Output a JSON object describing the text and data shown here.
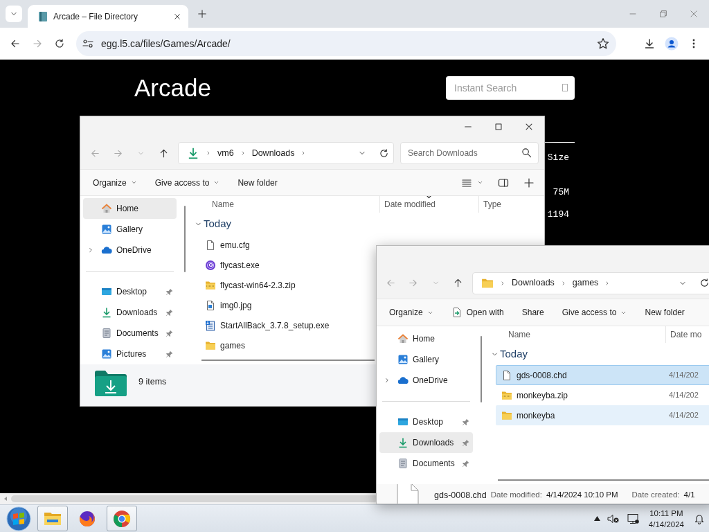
{
  "browser": {
    "tabs": [
      {
        "title": "Arcade – File Directory",
        "selected": true
      }
    ],
    "url": "egg.l5.ca/files/Games/Arcade/"
  },
  "page": {
    "heading": "Arcade",
    "search": {
      "placeholder": "Instant Search"
    },
    "table": {
      "columns": [
        "Size"
      ],
      "rows": [
        [
          "75M"
        ],
        [
          "1194"
        ]
      ]
    }
  },
  "windows": [
    {
      "caption_buttons": true,
      "location": {
        "kind": "downloads",
        "crumbs": [
          "vm6",
          "Downloads"
        ]
      },
      "search": {
        "placeholder": "Search Downloads"
      },
      "toolbar": [
        {
          "label": "Organize",
          "kind": "menu"
        },
        {
          "label": "Give access to",
          "kind": "menu"
        },
        {
          "label": "New folder",
          "kind": "plain"
        }
      ],
      "view_tools": true,
      "nav": [
        {
          "items": [
            {
              "label": "Home",
              "kind": "home",
              "selected": true,
              "expandable": false,
              "pinned": false
            },
            {
              "label": "Gallery",
              "kind": "gallery",
              "selected": false,
              "expandable": false,
              "pinned": false
            },
            {
              "label": "OneDrive",
              "kind": "cloud",
              "selected": false,
              "expandable": true,
              "pinned": false
            }
          ]
        },
        {
          "items": [
            {
              "label": "Desktop",
              "kind": "desktop",
              "selected": false,
              "expandable": false,
              "pinned": true
            },
            {
              "label": "Downloads",
              "kind": "downloads",
              "selected": false,
              "expandable": false,
              "pinned": true
            },
            {
              "label": "Documents",
              "kind": "documents",
              "selected": false,
              "expandable": false,
              "pinned": true
            },
            {
              "label": "Pictures",
              "kind": "pictures",
              "selected": false,
              "expandable": false,
              "pinned": true
            }
          ]
        }
      ],
      "columns": [
        {
          "label": "Name",
          "sorted": false
        },
        {
          "label": "Date modified",
          "sorted": true
        },
        {
          "label": "Type",
          "sorted": false
        }
      ],
      "group": "Today",
      "files": [
        {
          "name": "emu.cfg",
          "kind": "file",
          "selected": false,
          "hovered": false
        },
        {
          "name": "flycast.exe",
          "kind": "app",
          "selected": false,
          "hovered": false
        },
        {
          "name": "flycast-win64-2.3.zip",
          "kind": "zip",
          "selected": false,
          "hovered": false
        },
        {
          "name": "img0.jpg",
          "kind": "image",
          "selected": false,
          "hovered": false
        },
        {
          "name": "StartAllBack_3.7.8_setup.exe",
          "kind": "installer",
          "selected": false,
          "hovered": false
        },
        {
          "name": "games",
          "kind": "folder",
          "selected": false,
          "hovered": false
        }
      ],
      "status": {
        "kind": "count",
        "text": "9 items"
      }
    },
    {
      "caption_buttons": false,
      "location": {
        "kind": "folder",
        "crumbs": [
          "Downloads",
          "games"
        ]
      },
      "toolbar": [
        {
          "label": "Organize",
          "kind": "menu"
        },
        {
          "label": "Open with",
          "kind": "open-with"
        },
        {
          "label": "Share",
          "kind": "plain"
        },
        {
          "label": "Give access to",
          "kind": "menu"
        },
        {
          "label": "New folder",
          "kind": "plain"
        }
      ],
      "view_tools": false,
      "nav": [
        {
          "items": [
            {
              "label": "Home",
              "kind": "home",
              "selected": false,
              "expandable": false,
              "pinned": false
            },
            {
              "label": "Gallery",
              "kind": "gallery",
              "selected": false,
              "expandable": false,
              "pinned": false
            },
            {
              "label": "OneDrive",
              "kind": "cloud",
              "selected": false,
              "expandable": true,
              "pinned": false
            }
          ]
        },
        {
          "items": [
            {
              "label": "Desktop",
              "kind": "desktop",
              "selected": false,
              "expandable": false,
              "pinned": true
            },
            {
              "label": "Downloads",
              "kind": "downloads",
              "selected": true,
              "expandable": false,
              "pinned": true
            },
            {
              "label": "Documents",
              "kind": "documents",
              "selected": false,
              "expandable": false,
              "pinned": true
            }
          ]
        }
      ],
      "columns": [
        {
          "label": "Name",
          "sorted": false
        },
        {
          "label": "Date mo",
          "sorted": false
        }
      ],
      "group": "Today",
      "files": [
        {
          "name": "gds-0008.chd",
          "kind": "file",
          "date_modified": "4/14/202",
          "selected": true,
          "hovered": false
        },
        {
          "name": "monkeyba.zip",
          "kind": "zip",
          "date_modified": "4/14/202",
          "selected": false,
          "hovered": false
        },
        {
          "name": "monkeyba",
          "kind": "folder",
          "date_modified": "4/14/202",
          "selected": false,
          "hovered": true
        }
      ],
      "status": {
        "kind": "details",
        "name": "gds-0008.chd",
        "fields": [
          {
            "label": "Date modified:",
            "value": "4/14/2024 10:10 PM"
          },
          {
            "label": "Date created:",
            "value": "4/1"
          }
        ]
      }
    }
  ],
  "taskbar": {
    "apps": [
      {
        "kind": "folder",
        "running": true
      },
      {
        "kind": "fox",
        "running": false
      },
      {
        "kind": "chrome",
        "running": true
      }
    ],
    "clock": {
      "time": "10:11 PM",
      "date": "4/14/2024"
    }
  }
}
